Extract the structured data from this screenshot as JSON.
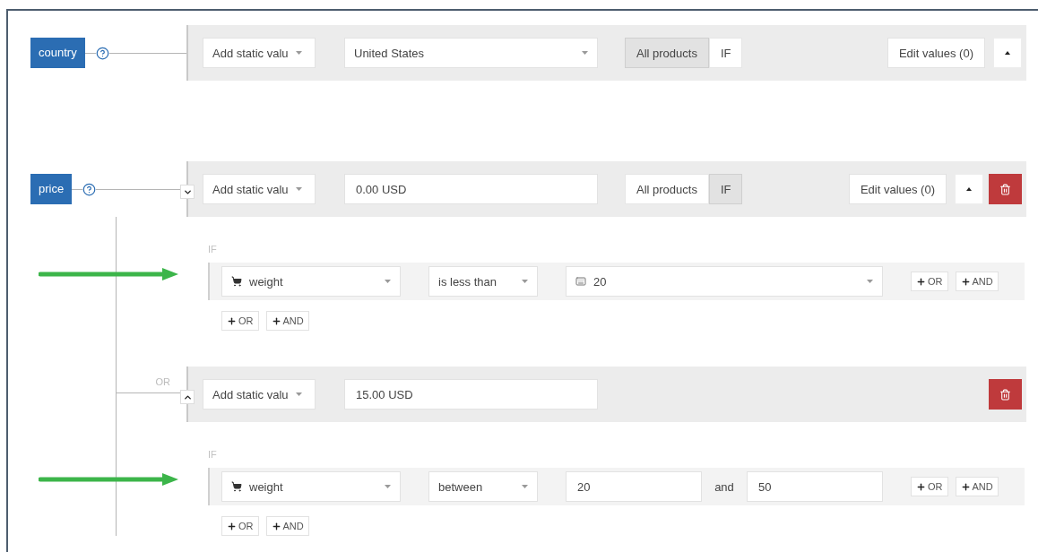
{
  "attributes": [
    {
      "name": "country",
      "rules": [
        {
          "source": "Add static valu",
          "value": {
            "kind": "select",
            "text": "United States"
          },
          "scope": [
            {
              "label": "All products",
              "selected": true
            },
            {
              "label": "IF",
              "selected": false
            }
          ],
          "edit_label": "Edit values (0)",
          "move_up": true,
          "deletable": false
        }
      ]
    },
    {
      "name": "price",
      "rules": [
        {
          "expanded": true,
          "source": "Add static valu",
          "value": {
            "kind": "input",
            "text": "0.00 USD"
          },
          "scope": [
            {
              "label": "All products",
              "selected": false
            },
            {
              "label": "IF",
              "selected": true
            }
          ],
          "edit_label": "Edit values (0)",
          "move_up": true,
          "deletable": true,
          "conditions": {
            "label": "IF",
            "arrow": true,
            "rows": [
              {
                "field": "weight",
                "operator": "is less than",
                "operand": {
                  "kind": "select",
                  "text": "20"
                },
                "buttons": [
                  "OR",
                  "AND"
                ]
              }
            ],
            "buttons": [
              "OR",
              "AND"
            ]
          }
        },
        {
          "connector": "OR",
          "expanded": false,
          "source": "Add static valu",
          "value": {
            "kind": "input",
            "text": "15.00 USD"
          },
          "move_up": false,
          "deletable": true,
          "conditions": {
            "label": "IF",
            "arrow": true,
            "rows": [
              {
                "field": "weight",
                "operator": "between",
                "operand": {
                  "kind": "range",
                  "from": "20",
                  "joiner": "and",
                  "to": "50"
                },
                "buttons": [
                  "OR",
                  "AND"
                ]
              }
            ],
            "buttons": [
              "OR",
              "AND"
            ]
          }
        }
      ]
    }
  ]
}
